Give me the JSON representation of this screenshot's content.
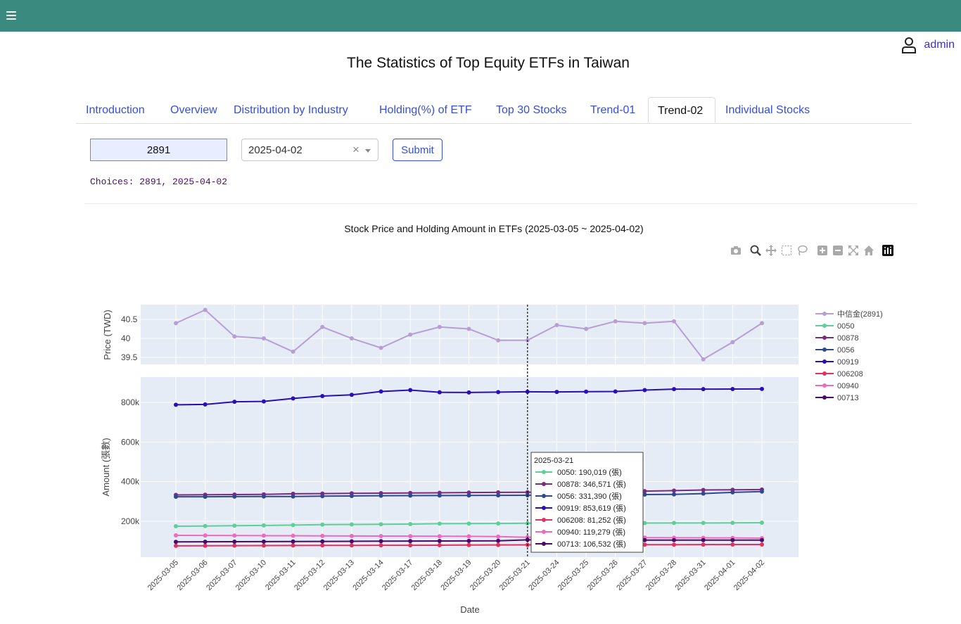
{
  "header": {
    "menu_icon": "hamburger-menu-icon",
    "user_icon": "user-account-icon",
    "username": "admin",
    "bar_color": "#3a8a80"
  },
  "page_title": "The Statistics of Top Equity ETFs in Taiwan",
  "tabs": [
    {
      "label": "Introduction",
      "active": false
    },
    {
      "label": "Overview",
      "active": false
    },
    {
      "label": "Distribution by Industry",
      "active": false
    },
    {
      "label": "Holding(%) of ETF",
      "active": false
    },
    {
      "label": "Top 30 Stocks",
      "active": false
    },
    {
      "label": "Trend-01",
      "active": false
    },
    {
      "label": "Trend-02",
      "active": true
    },
    {
      "label": "Individual Stocks",
      "active": false
    }
  ],
  "form": {
    "stock_code": "2891",
    "date_value": "2025-04-02",
    "clear_symbol": "×",
    "submit_label": "Submit",
    "choices_text": "Choices: 2891, 2025-04-02"
  },
  "modebar": [
    "camera-icon",
    "zoom-icon",
    "pan-icon",
    "box-select-icon",
    "lasso-select-icon",
    "zoom-in-icon",
    "zoom-out-icon",
    "autoscale-icon",
    "reset-axes-icon",
    "plotly-logo-icon"
  ],
  "chart_data": {
    "type": "line",
    "title": "Stock Price and Holding Amount in ETFs (2025-03-05 ~ 2025-04-02)",
    "xlabel": "Date",
    "x": [
      "2025-03-05",
      "2025-03-06",
      "2025-03-07",
      "2025-03-10",
      "2025-03-11",
      "2025-03-12",
      "2025-03-13",
      "2025-03-14",
      "2025-03-17",
      "2025-03-18",
      "2025-03-19",
      "2025-03-20",
      "2025-03-21",
      "2025-03-24",
      "2025-03-25",
      "2025-03-26",
      "2025-03-27",
      "2025-03-28",
      "2025-03-31",
      "2025-04-01",
      "2025-04-02"
    ],
    "legend_position": "right",
    "grid": true,
    "price_panel": {
      "ylabel": "Price (TWD)",
      "yticks": [
        "39.5",
        "40",
        "40.5"
      ],
      "ylim": [
        39.3,
        40.85
      ],
      "series": [
        {
          "name": "中信金(2891)",
          "color": "#b79fd6",
          "values": [
            40.4,
            40.75,
            40.05,
            40.0,
            39.65,
            40.3,
            40.0,
            39.75,
            40.1,
            40.3,
            40.25,
            39.95,
            39.95,
            40.35,
            40.25,
            40.45,
            40.4,
            40.45,
            39.45,
            39.9,
            40.4
          ]
        }
      ]
    },
    "amount_panel": {
      "ylabel": "Amount (張數)",
      "yticks": [
        "200k",
        "400k",
        "600k",
        "800k"
      ],
      "ylim": [
        0,
        900000
      ],
      "series": [
        {
          "name": "0050",
          "color": "#5fcf9a",
          "values": [
            175000,
            176000,
            178000,
            179000,
            181000,
            183000,
            184000,
            185000,
            186000,
            188000,
            188500,
            189000,
            190019,
            190500,
            190500,
            191000,
            191000,
            191500,
            191500,
            192000,
            193000
          ]
        },
        {
          "name": "00878",
          "color": "#7a2a84",
          "values": [
            333000,
            334000,
            335000,
            336000,
            339000,
            340000,
            341000,
            342000,
            343000,
            344000,
            345000,
            346000,
            346571,
            347000,
            347500,
            348000,
            352000,
            355000,
            358000,
            359000,
            360000
          ]
        },
        {
          "name": "0056",
          "color": "#2f4a8c",
          "values": [
            324000,
            324000,
            324500,
            325000,
            325000,
            327000,
            328000,
            329000,
            329500,
            330000,
            330500,
            331000,
            331390,
            332000,
            333000,
            334000,
            335000,
            336000,
            340000,
            346000,
            350000
          ]
        },
        {
          "name": "00919",
          "color": "#2a0fb5",
          "values": [
            788000,
            790000,
            803000,
            805000,
            820000,
            832000,
            838000,
            855000,
            862000,
            851000,
            850000,
            852000,
            853619,
            853000,
            854000,
            855000,
            862000,
            867000,
            867000,
            867500,
            868000
          ]
        },
        {
          "name": "006208",
          "color": "#e0325f",
          "values": [
            76000,
            76500,
            77000,
            77500,
            78000,
            78500,
            78500,
            79000,
            79000,
            79500,
            80000,
            80500,
            81252,
            81300,
            81500,
            81500,
            81800,
            82000,
            82500,
            82800,
            83000
          ]
        },
        {
          "name": "00940",
          "color": "#ee6ac0",
          "values": [
            129000,
            128500,
            128000,
            127500,
            127000,
            126500,
            126000,
            125500,
            125000,
            124500,
            124000,
            123000,
            119279,
            119000,
            118500,
            118000,
            117500,
            117000,
            116500,
            116000,
            115000
          ]
        },
        {
          "name": "00713",
          "color": "#4a0a6a",
          "values": [
            96000,
            96500,
            97000,
            97500,
            98000,
            98500,
            99000,
            99500,
            100000,
            100500,
            101000,
            101500,
            106532,
            106000,
            105800,
            105500,
            105200,
            105000,
            105000,
            105000,
            105000
          ]
        }
      ]
    },
    "hover": {
      "index": 12,
      "date": "2025-03-21",
      "unit": "(張)",
      "rows": [
        {
          "name": "0050",
          "value": "190,019"
        },
        {
          "name": "00878",
          "value": "346,571"
        },
        {
          "name": "0056",
          "value": "331,390"
        },
        {
          "name": "00919",
          "value": "853,619"
        },
        {
          "name": "006208",
          "value": "81,252"
        },
        {
          "name": "00940",
          "value": "119,279"
        },
        {
          "name": "00713",
          "value": "106,532"
        }
      ]
    }
  }
}
